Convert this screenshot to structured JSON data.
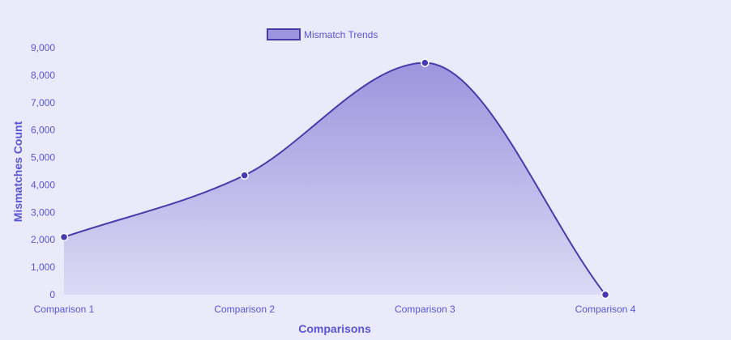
{
  "chart_data": {
    "type": "area",
    "categories": [
      "Comparison 1",
      "Comparison 2",
      "Comparison 3",
      "Comparison 4"
    ],
    "series": [
      {
        "name": "Mismatch Trends",
        "values": [
          2100,
          4350,
          8450,
          0
        ]
      }
    ],
    "xlabel": "Comparisons",
    "ylabel": "Mismatches Count",
    "ylim": [
      0,
      9000
    ],
    "yticks": [
      "0",
      "1,000",
      "2,000",
      "3,000",
      "4,000",
      "5,000",
      "6,000",
      "7,000",
      "8,000",
      "9,000"
    ],
    "grid": false,
    "legend_position": "top-center",
    "smooth": true
  },
  "colors": {
    "background": "#eaeafb",
    "line": "#4b3aad",
    "fill_top": "#9d94dd",
    "fill_bottom": "#dcdaf5",
    "point": "#4b3aad",
    "point_border": "#ffffff",
    "text": "#5a55d6",
    "axis_line": "#d6d4ee"
  }
}
